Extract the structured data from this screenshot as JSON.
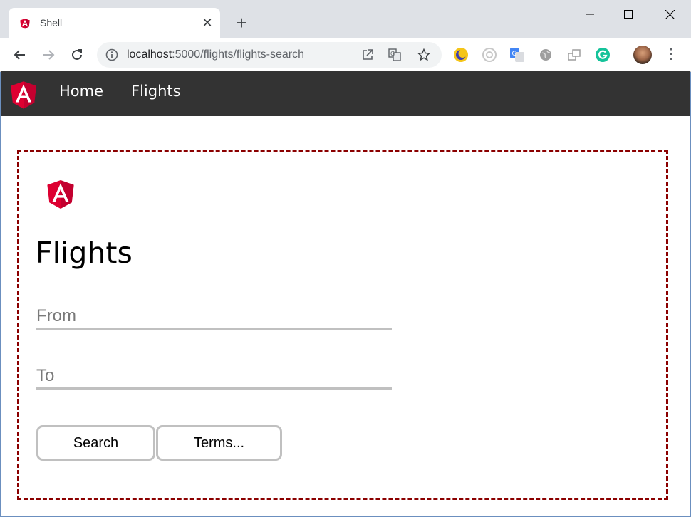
{
  "browser": {
    "tab": {
      "title": "Shell"
    },
    "address_bar": {
      "host": "localhost",
      "rest": ":5000/flights/flights-search"
    }
  },
  "navbar": {
    "links": [
      {
        "label": "Home"
      },
      {
        "label": "Flights"
      }
    ]
  },
  "page": {
    "title": "Flights",
    "from_field": {
      "placeholder": "From",
      "value": ""
    },
    "to_field": {
      "placeholder": "To",
      "value": ""
    },
    "search_button": "Search",
    "terms_button": "Terms..."
  },
  "colors": {
    "angular_red": "#dd0031",
    "navbar_bg": "#333333",
    "frame_border": "#8b0000"
  }
}
